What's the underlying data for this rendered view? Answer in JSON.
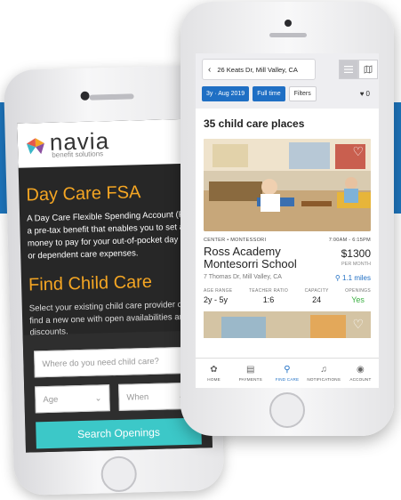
{
  "navia": {
    "logo_word": "navia",
    "logo_sub": "benefit solutions",
    "heading1": "Day Care FSA",
    "para1_lines": [
      "A Day Care Flexible Spending Account (FSA",
      "a pre-tax benefit that enables you to set a",
      "money to pay for your out-of-pocket day c",
      "or dependent care expenses."
    ],
    "heading2": "Find Child Care",
    "para2_lines": [
      "Select your existing child care provider or",
      "find a new one with open availabilities and",
      "discounts."
    ],
    "search_placeholder": "Where do you need child care?",
    "age_label": "Age",
    "when_label": "When",
    "search_button": "Search Openings",
    "colors": {
      "accent": "#f5a623",
      "button": "#3cc8c8",
      "background": "#272727"
    }
  },
  "childcare": {
    "address": "26 Keats Dr, Mill Valley, CA",
    "filters": {
      "age": "3y · Aug 2019",
      "schedule": "Full time",
      "more": "Filters"
    },
    "favorites_count": "0",
    "results_title": "35 child care places",
    "listing": {
      "category": "CENTER • MONTESSORI",
      "hours": "7:00AM - 6:15PM",
      "name_line1": "Ross Academy",
      "name_line2": "Montesorri School",
      "price": "$1300",
      "price_unit": "PER MONTH",
      "address": "7 Thomas Dr, Mill Valley, CA",
      "distance": "1.1 miles",
      "stats": [
        {
          "label": "AGE RANGE",
          "value": "2y - 5y"
        },
        {
          "label": "TEACHER RATIO",
          "value": "1:6"
        },
        {
          "label": "CAPACITY",
          "value": "24"
        },
        {
          "label": "OPENINGS",
          "value": "Yes"
        }
      ]
    },
    "tabs": [
      {
        "label": "HOME",
        "icon": "home-icon"
      },
      {
        "label": "PAYMENTS",
        "icon": "payments-icon"
      },
      {
        "label": "FIND CARE",
        "icon": "search-icon"
      },
      {
        "label": "NOTIFICATIONS",
        "icon": "bell-icon"
      },
      {
        "label": "ACCOUNT",
        "icon": "account-icon"
      }
    ],
    "colors": {
      "primary": "#1f6fc4",
      "success": "#3cb043"
    }
  }
}
